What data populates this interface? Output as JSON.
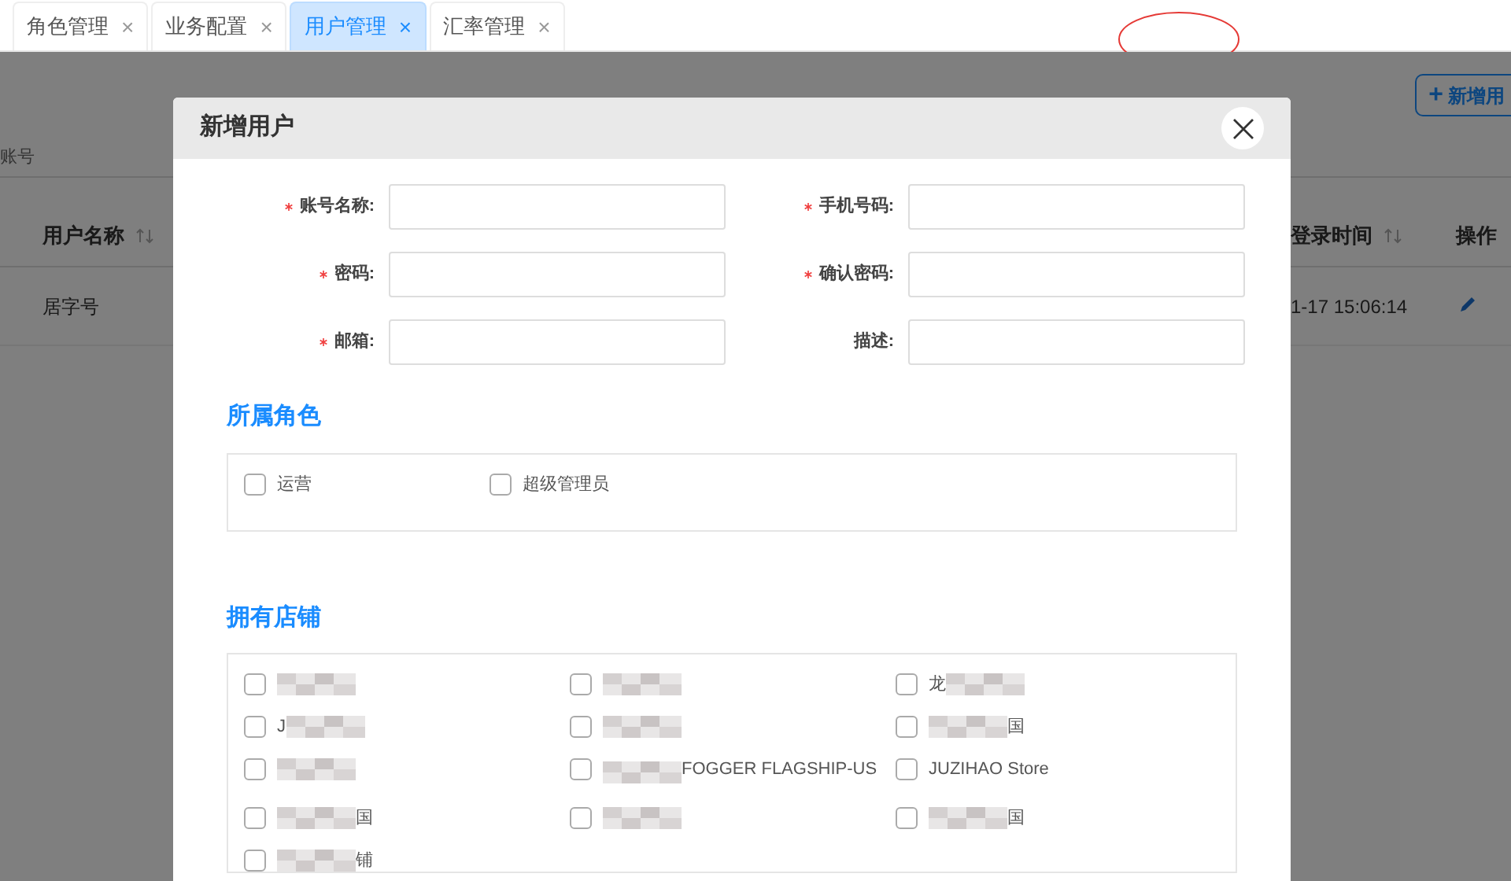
{
  "tabs": [
    {
      "label": "角色管理",
      "close": "×",
      "selected": false
    },
    {
      "label": "业务配置",
      "close": "×",
      "selected": false
    },
    {
      "label": "用户管理",
      "close": "×",
      "selected": true
    },
    {
      "label": "汇率管理",
      "close": "×",
      "selected": false
    }
  ],
  "page": {
    "new_button": {
      "icon": "+",
      "label": "新增用"
    },
    "filter_label": "账号",
    "table": {
      "columns": [
        {
          "label": "用户名称",
          "sortable": true
        },
        {
          "label": "登录时间",
          "sortable": true
        },
        {
          "label": "操作",
          "sortable": false
        }
      ],
      "rows": [
        {
          "cells": [
            "居字号",
            "1-17 15:06:14"
          ]
        }
      ]
    }
  },
  "modal": {
    "title": "新增用户",
    "fields": [
      {
        "label": "账号名称:",
        "required": true
      },
      {
        "label": "手机号码:",
        "required": true
      },
      {
        "label": "密码:",
        "required": true
      },
      {
        "label": "确认密码:",
        "required": true
      },
      {
        "label": "邮箱:",
        "required": true
      },
      {
        "label": "描述:",
        "required": false
      }
    ],
    "sections": [
      {
        "title": "所属角色",
        "options": [
          {
            "kind": "plain",
            "label": "运营",
            "checked": false
          },
          {
            "kind": "plain",
            "label": "超级管理员",
            "checked": false
          }
        ]
      },
      {
        "title": "拥有店铺",
        "options": [
          {
            "kind": "redacted",
            "checked": false
          },
          {
            "kind": "redacted",
            "checked": false
          },
          {
            "kind": "redacted",
            "prefix": "龙",
            "checked": false
          },
          {
            "kind": "redacted",
            "prefix": "J",
            "checked": false
          },
          {
            "kind": "redacted",
            "checked": false
          },
          {
            "kind": "redacted",
            "suffix": "国",
            "checked": false
          },
          {
            "kind": "redacted",
            "checked": false
          },
          {
            "kind": "redacted",
            "suffix": "FOGGER FLAGSHIP-US",
            "checked": false
          },
          {
            "kind": "plain",
            "label": "JUZIHAO Store",
            "checked": false
          },
          {
            "kind": "redacted",
            "suffix": "国",
            "checked": false
          },
          {
            "kind": "redacted",
            "checked": false
          },
          {
            "kind": "redacted",
            "suffix": "国",
            "checked": false
          },
          {
            "kind": "redacted",
            "suffix": "铺",
            "checked": false
          }
        ]
      }
    ]
  }
}
